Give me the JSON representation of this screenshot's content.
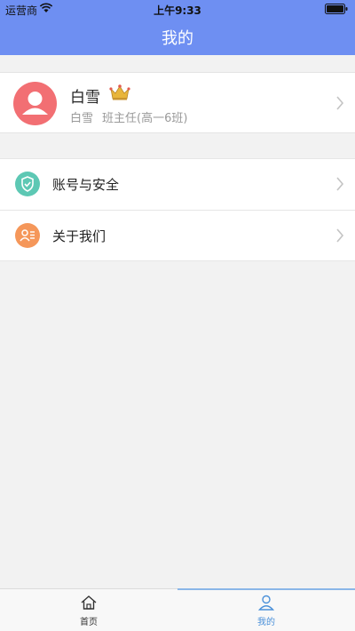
{
  "status_bar": {
    "carrier": "运营商",
    "time": "上午9:33"
  },
  "nav": {
    "title": "我的"
  },
  "profile": {
    "name": "白雪",
    "sub_name": "白雪",
    "role": "班主任(高一6班)"
  },
  "menu": {
    "items": [
      {
        "label": "账号与安全",
        "icon": "shield-icon",
        "color": "#5dc8b4"
      },
      {
        "label": "关于我们",
        "icon": "contact-card-icon",
        "color": "#f5975a"
      }
    ]
  },
  "tabbar": {
    "tabs": [
      {
        "label": "首页",
        "icon": "home-icon",
        "active": false
      },
      {
        "label": "我的",
        "icon": "user-icon",
        "active": true
      }
    ]
  },
  "colors": {
    "nav_bg": "#6e8ff2",
    "avatar_bg": "#f26f73",
    "active_tab": "#4a90d9"
  }
}
